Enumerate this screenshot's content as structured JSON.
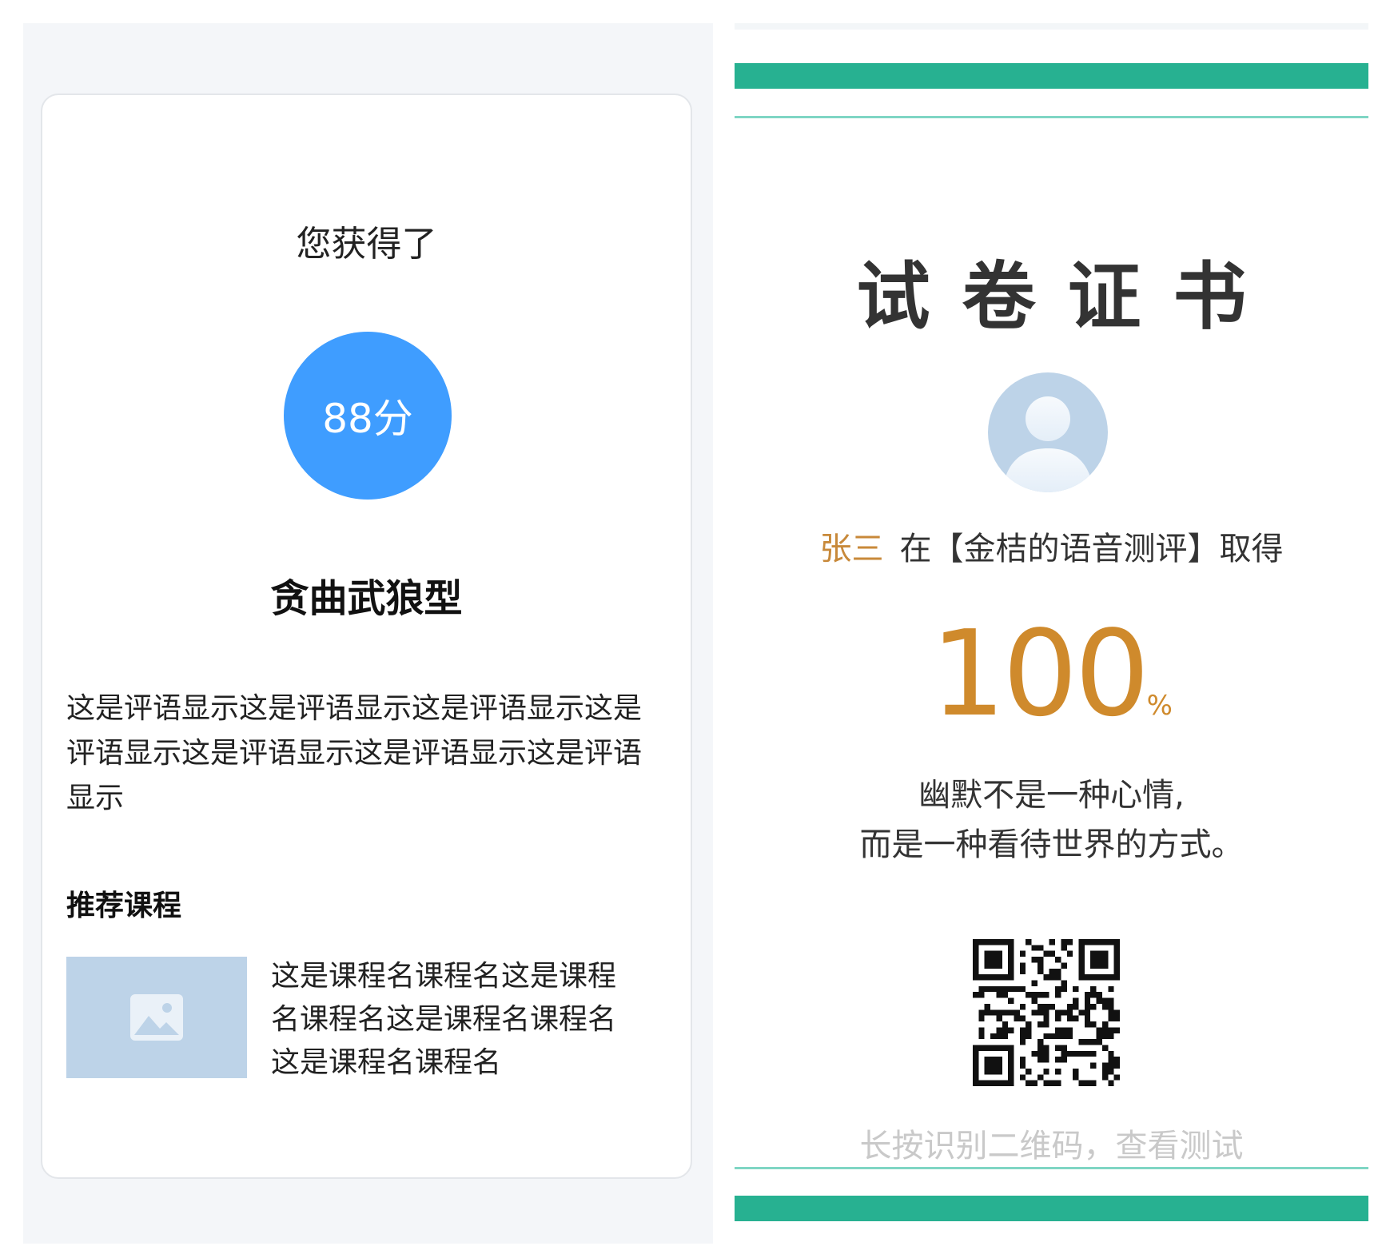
{
  "result": {
    "heading": "您获得了",
    "score": "88分",
    "type_title": "贪曲武狼型",
    "comment": "这是评语显示这是评语显示这是评语显示这是评语显示这是评语显示这是评语显示这是评语显示",
    "recommend_title": "推荐课程",
    "course": {
      "name": "这是课程名课程名这是课程名课程名这是课程名课程名这是课程名课程名",
      "thumb_icon": "image-placeholder-icon"
    }
  },
  "certificate": {
    "title": "试卷证书",
    "name": "张三",
    "line_text": "在【金桔的语音测评】取得",
    "score_value": "100",
    "score_unit": "%",
    "quote_line1": "幽默不是一种心情,",
    "quote_line2": "而是一种看待世界的方式。",
    "qr_caption": "长按识别二维码，查看测试",
    "avatar_icon": "user-avatar-icon",
    "qr_icon": "qr-code-icon"
  },
  "colors": {
    "score_circle": "#3f9dff",
    "stripe": "#27b191",
    "stripe_thin": "#7fd6c4",
    "gold": "#cf8a2c",
    "thumb": "#bdd3e8"
  }
}
